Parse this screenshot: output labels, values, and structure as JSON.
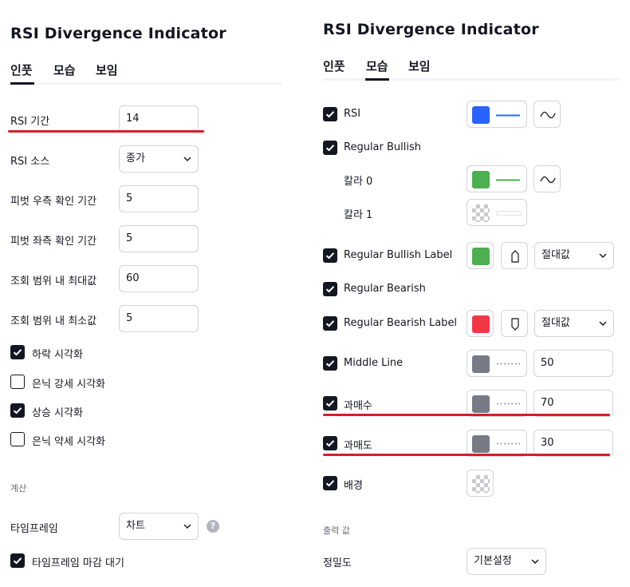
{
  "left": {
    "title": "RSI Divergence Indicator",
    "tabs": [
      "인풋",
      "모습",
      "보임"
    ],
    "fields": [
      {
        "label": "RSI 기간",
        "value": "14"
      },
      {
        "label": "RSI 소스",
        "value": "종가"
      },
      {
        "label": "피벗 우측 확인 기간",
        "value": "5"
      },
      {
        "label": "피벗 좌측 확인 기간",
        "value": "5"
      },
      {
        "label": "조회 범위 내 최대값",
        "value": "60"
      },
      {
        "label": "조회 범위 내 최소값",
        "value": "5"
      }
    ],
    "checks": [
      {
        "label": "하락 시각화",
        "checked": true
      },
      {
        "label": "은닉 강세 시각화",
        "checked": false
      },
      {
        "label": "상승 시각화",
        "checked": true
      },
      {
        "label": "은닉 약세 시각화",
        "checked": false
      }
    ],
    "section_calc": "계산",
    "timeframe_label": "타임프레임",
    "timeframe_value": "차트",
    "help_glyph": "?",
    "wait_close_label": "타임프레임 마감 대기"
  },
  "right": {
    "title": "RSI Divergence Indicator",
    "tabs": [
      "인풋",
      "모습",
      "보임"
    ],
    "rows": {
      "rsi": "RSI",
      "regular_bullish": "Regular Bullish",
      "color0": "칼라 0",
      "color1": "칼라 1",
      "regular_bullish_label": "Regular Bullish Label",
      "regular_bearish": "Regular Bearish",
      "regular_bearish_label": "Regular Bearish Label",
      "middle_line": "Middle Line",
      "overbought": "과매수",
      "oversold": "과매도",
      "background": "배경"
    },
    "values": {
      "bullish_label_mode": "절대값",
      "bearish_label_mode": "절대값",
      "middle_line": "50",
      "overbought": "70",
      "oversold": "30"
    },
    "section_output": "출력 값",
    "precision_label": "정밀도",
    "precision_value": "기본설정"
  },
  "colors": {
    "rsi": "#2962ff",
    "bullish": "#4caf50",
    "bearish": "#f23645",
    "line_gray": "#787b86",
    "annotation_red": "#d32027"
  }
}
